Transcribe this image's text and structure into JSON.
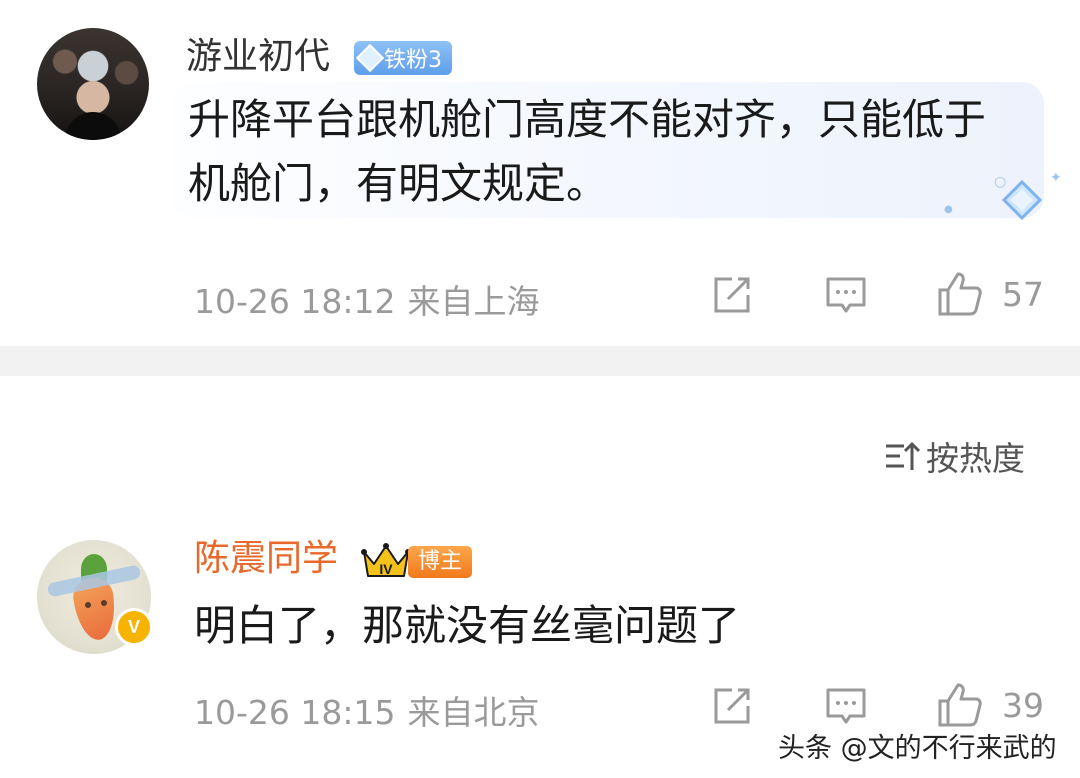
{
  "comments": [
    {
      "username": "游业初代",
      "fan_badge": "铁粉3",
      "text": "升降平台跟机舱门高度不能对齐，只能低于机舱门，有明文规定。",
      "date_time": "10-26 18:12",
      "location": "来自上海",
      "like_count": "57"
    },
    {
      "username": "陈震同学",
      "role_tag": "博主",
      "crown_level": "IV",
      "verified_mark": "V",
      "text": "明白了，那就没有丝毫问题了",
      "date_time": "10-26 18:15",
      "location": "来自北京",
      "like_count": "39"
    }
  ],
  "sort": {
    "icon": "sort-icon",
    "label": "按热度"
  },
  "icons": {
    "share": "share-icon",
    "comment": "comment-icon",
    "like": "like-icon"
  },
  "colors": {
    "accent_username": "#e8692b",
    "meta_gray": "#9a9a9a",
    "fan_badge_blue": "#6fa9ee",
    "blogger_orange": "#f08a2a"
  },
  "watermark": "头条 @文的不行来武的"
}
